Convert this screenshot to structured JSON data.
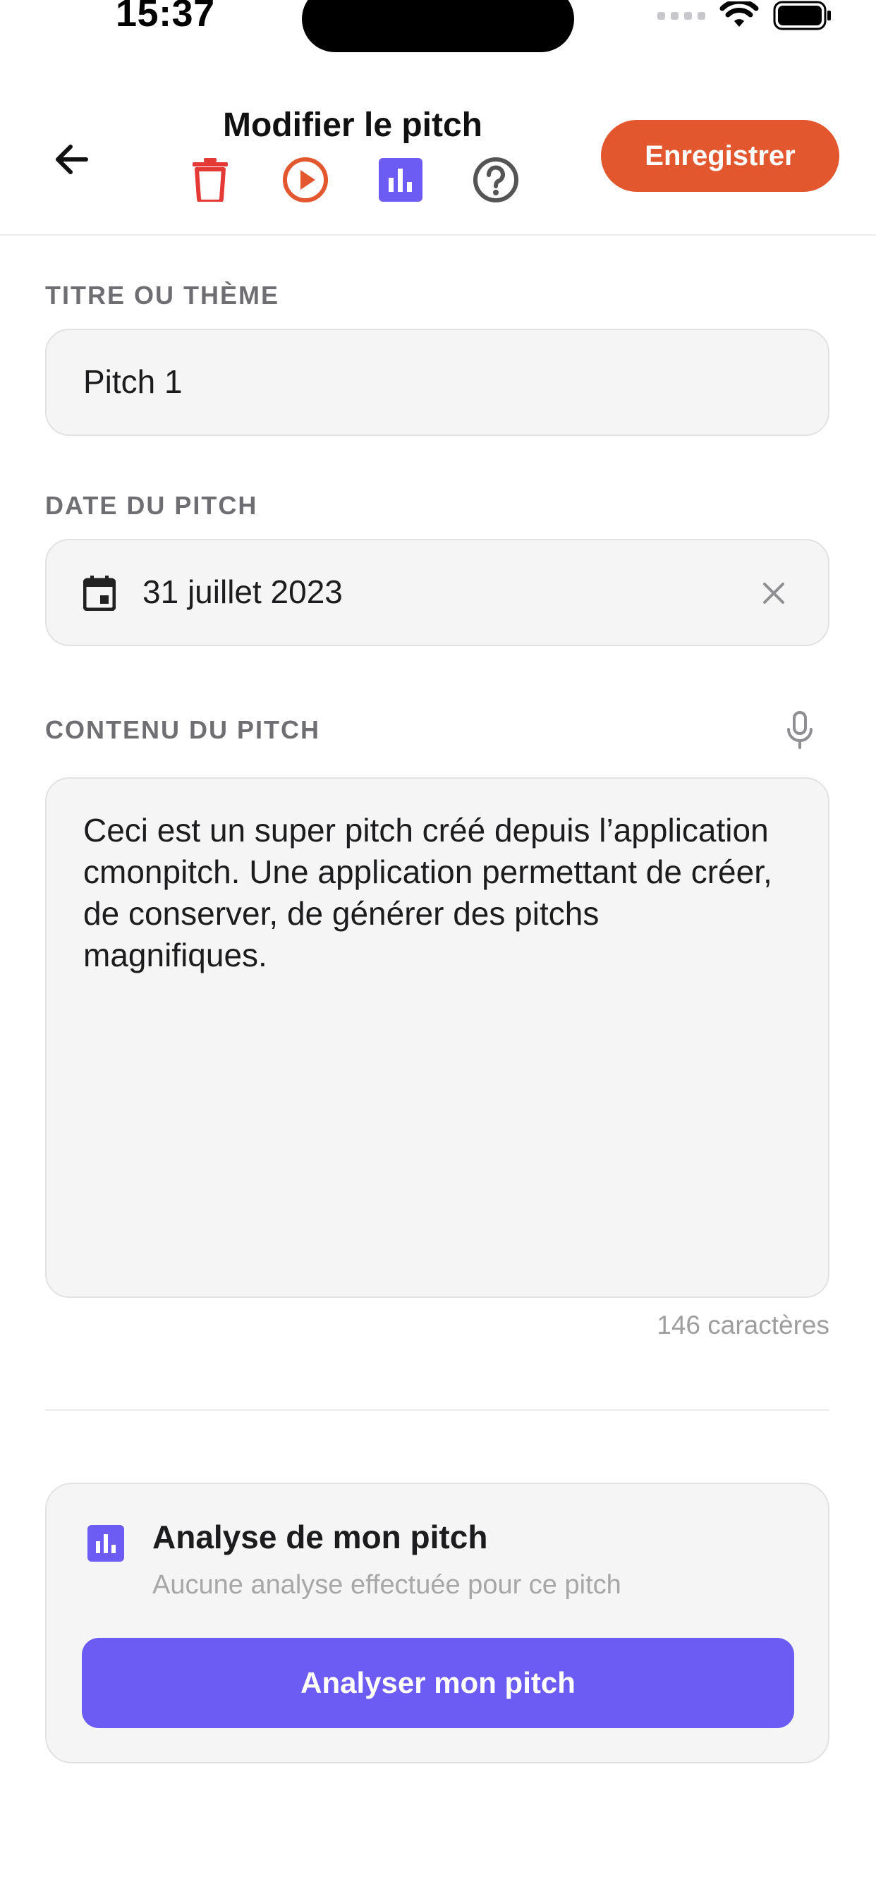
{
  "status_bar": {
    "time": "15:37"
  },
  "header": {
    "title": "Modifier le pitch",
    "save_label": "Enregistrer",
    "icons": [
      "arrow-left-icon",
      "trash-icon",
      "play-icon",
      "chart-icon",
      "help-icon"
    ]
  },
  "form": {
    "title_label": "TITRE OU THÈME",
    "title_value": "Pitch 1",
    "date_label": "DATE DU PITCH",
    "date_value": "31 juillet 2023",
    "content_label": "CONTENU DU PITCH",
    "content_value": "Ceci est un super pitch créé depuis l’application cmonpitch. Une application permettant de créer, de conserver, de générer des pitchs magnifiques.",
    "char_count": "146 caractères"
  },
  "analysis": {
    "title": "Analyse de mon pitch",
    "subtitle": "Aucune analyse effectuée pour ce pitch",
    "button_label": "Analyser mon pitch"
  },
  "colors": {
    "accent_orange": "#e3572f",
    "accent_purple": "#6c5cf3",
    "danger_red": "#e53935"
  }
}
